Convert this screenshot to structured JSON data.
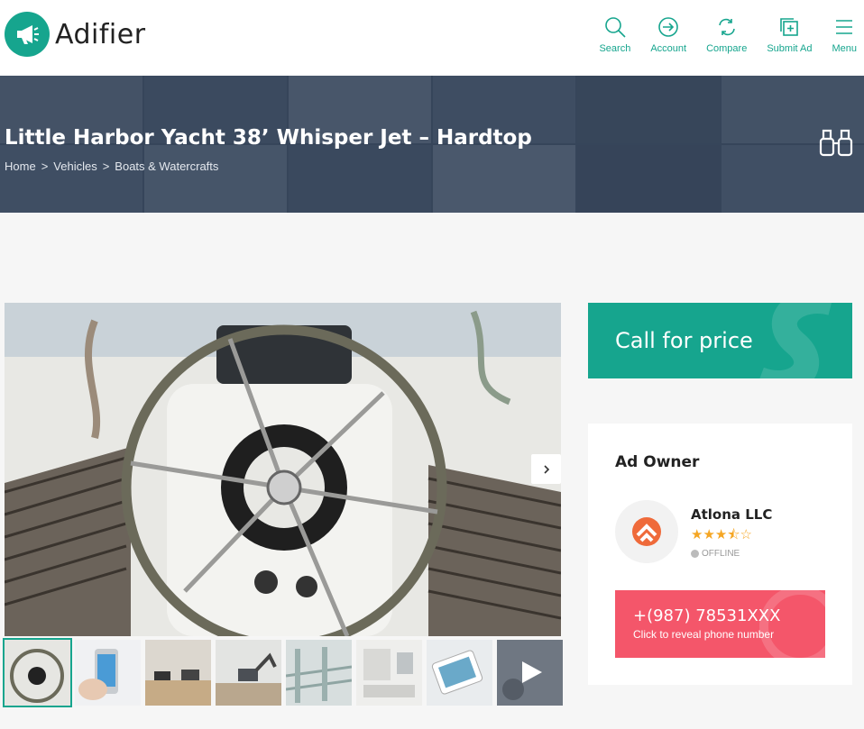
{
  "brand": {
    "name": "Adifier",
    "accent": "#16a58e",
    "danger": "#f4566a"
  },
  "nav": [
    {
      "label": "Search",
      "icon": "search-icon"
    },
    {
      "label": "Account",
      "icon": "login-icon"
    },
    {
      "label": "Compare",
      "icon": "compare-icon"
    },
    {
      "label": "Submit Ad",
      "icon": "submit-ad-icon"
    },
    {
      "label": "Menu",
      "icon": "menu-icon"
    }
  ],
  "hero": {
    "title": "Little Harbor Yacht 38’ Whisper Jet – Hardtop",
    "breadcrumbs": [
      "Home",
      ">",
      "Vehicles",
      ">",
      "Boats & Watercrafts"
    ]
  },
  "gallery": {
    "thumbnails": [
      "yacht-wheel",
      "smartphone",
      "desert-vehicles",
      "excavator",
      "glass-railing",
      "interior",
      "tablet",
      "video"
    ]
  },
  "price": {
    "label": "Call for price"
  },
  "owner": {
    "section_title": "Ad Owner",
    "name": "Atlona LLC",
    "rating": 3.5,
    "stars_text": "★★★⯪☆",
    "status": "OFFLINE",
    "phone": "+(987) 78531XXX",
    "phone_hint": "Click to reveal phone number"
  }
}
